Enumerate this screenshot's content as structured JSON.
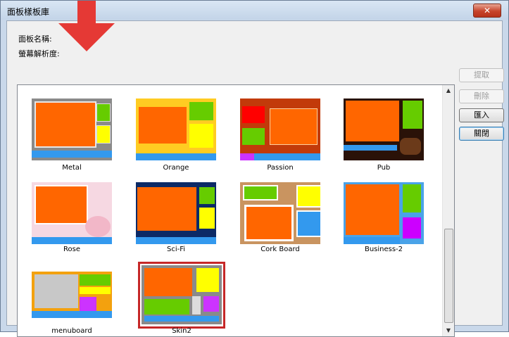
{
  "window": {
    "title": "面板樣板庫",
    "close_label": "✕"
  },
  "fields": {
    "panel_name_label": "面板名稱:",
    "resolution_label": "螢幕解析度:"
  },
  "buttons": [
    {
      "label": "提取",
      "enabled": false
    },
    {
      "label": "刪除",
      "enabled": false
    },
    {
      "label": "匯入",
      "enabled": true
    },
    {
      "label": "關閉",
      "enabled": true
    }
  ],
  "templates": [
    {
      "name": "Metal"
    },
    {
      "name": "Orange"
    },
    {
      "name": "Passion"
    },
    {
      "name": "Pub"
    },
    {
      "name": "Rose"
    },
    {
      "name": "Sci-Fi"
    },
    {
      "name": "Cork Board"
    },
    {
      "name": "Business-2"
    },
    {
      "name": "menuboard"
    },
    {
      "name": "Skin2",
      "selected": true
    }
  ],
  "colors": {
    "accent_orange": "#ff6600",
    "selection_border": "#c62828",
    "arrow": "#e53935"
  }
}
